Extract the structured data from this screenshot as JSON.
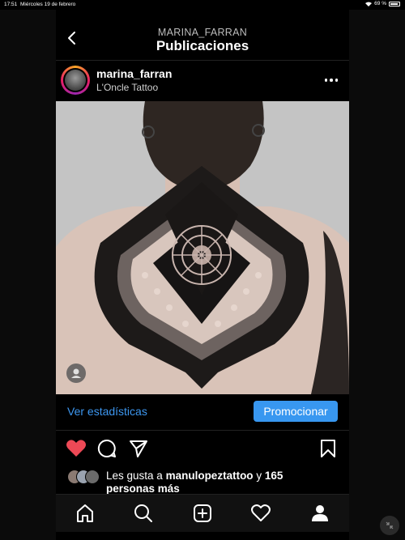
{
  "status_bar": {
    "time": "17:51",
    "date": "Miércoles 19 de febrero",
    "battery": "69 %"
  },
  "nav": {
    "subtitle": "MARINA_FARRAN",
    "title": "Publicaciones"
  },
  "post": {
    "username": "marina_farran",
    "location": "L'Oncle Tattoo",
    "image_subject": "back tattoo photo"
  },
  "stats": {
    "link": "Ver estadísticas",
    "promote": "Promocionar"
  },
  "likes": {
    "prefix": "Les gusta a ",
    "user": "manulopeztattoo",
    "middle": " y ",
    "count": "165",
    "suffix": "personas más"
  },
  "colors": {
    "accent": "#3897f0",
    "heart": "#ed4956",
    "background": "#000000"
  },
  "icons": {
    "back": "chevron-left-icon",
    "more": "more-horizontal-icon",
    "like": "heart-filled-icon",
    "comment": "comment-icon",
    "share": "send-icon",
    "save": "bookmark-icon",
    "tabs": [
      "home-icon",
      "search-icon",
      "add-icon",
      "activity-heart-icon",
      "profile-icon"
    ]
  }
}
